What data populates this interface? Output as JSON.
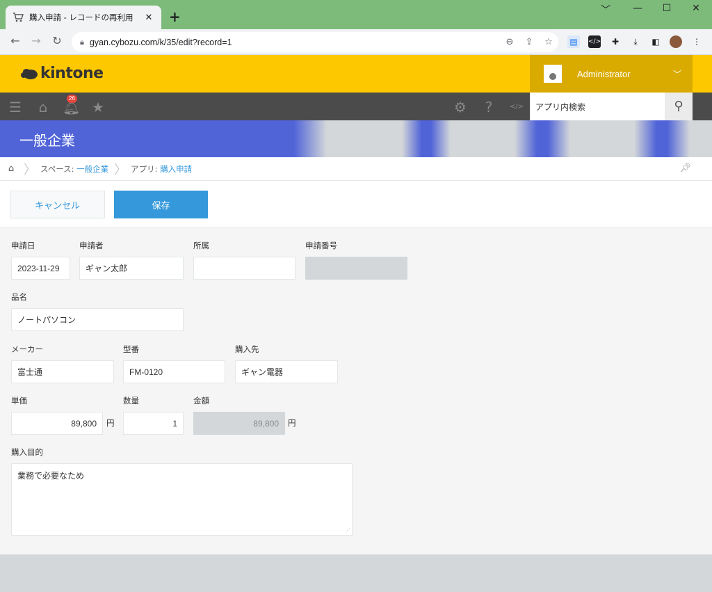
{
  "browser": {
    "tab_title": "購入申請 - レコードの再利用",
    "tab_close": "✕",
    "new_tab": "+",
    "url": "gyan.cybozu.com/k/35/edit?record=1",
    "window_controls": [
      "﹀",
      "—",
      "☐",
      "✕"
    ]
  },
  "kintone": {
    "logo_text": "kintone",
    "user_name": "Administrator",
    "notification_count": "26",
    "search_placeholder": "アプリ内検索"
  },
  "space": {
    "title": "一般企業"
  },
  "breadcrumb": {
    "space_prefix": "スペース: ",
    "space_name": "一般企業",
    "app_prefix": "アプリ: ",
    "app_name": "購入申請"
  },
  "actions": {
    "cancel_label": "キャンセル",
    "save_label": "保存"
  },
  "form": {
    "date_label": "申請日",
    "date_value": "2023-11-29",
    "applicant_label": "申請者",
    "applicant_value": "ギャン太郎",
    "department_label": "所属",
    "department_value": "",
    "number_label": "申請番号",
    "number_value": "",
    "item_label": "品名",
    "item_value": "ノートパソコン",
    "maker_label": "メーカー",
    "maker_value": "富士通",
    "model_label": "型番",
    "model_value": "FM-0120",
    "vendor_label": "購入先",
    "vendor_value": "ギャン電器",
    "price_label": "単価",
    "price_value": "89,800",
    "price_unit": "円",
    "qty_label": "数量",
    "qty_value": "1",
    "amount_label": "金額",
    "amount_value": "89,800",
    "amount_unit": "円",
    "purpose_label": "購入目的",
    "purpose_value": "業務で必要なため"
  },
  "colors": {
    "header_yellow": "#fec800",
    "user_area": "#d9ab00",
    "nav_dark": "#4b4b4b",
    "space_blue": "#5064d8",
    "primary_blue": "#3498db"
  }
}
